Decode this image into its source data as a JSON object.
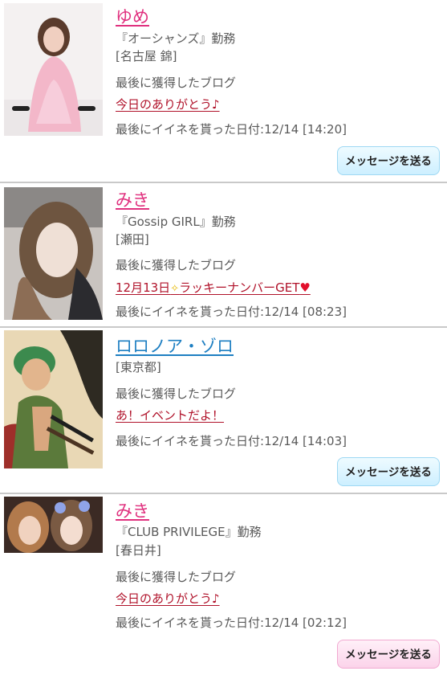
{
  "labels": {
    "last_blog": "最後に獲得したブログ",
    "last_like_prefix": "最後にイイネを貰った日付:",
    "message_button": "メッセージを送る"
  },
  "cards": [
    {
      "name": "ゆめ",
      "name_color": "#e0307e",
      "shop": "『オーシャンズ』勤務",
      "area": "[名古屋 錦]",
      "blog_title": "今日のありがとう♪",
      "like_date": "12/14 [14:20]"
    },
    {
      "name": "みき",
      "name_color": "#e0307e",
      "shop": "『Gossip GIRL』勤務",
      "area": "[瀬田]",
      "blog_title_a": "12月13日",
      "blog_title_b": "ラッキーナンバーGET",
      "like_date": "12/14 [08:23]"
    },
    {
      "name": "ロロノア・ゾロ",
      "name_color": "#1e7fc2",
      "area": "[東京都]",
      "blog_title": "あ！イベントだよ！",
      "like_date": "12/14 [14:03]"
    },
    {
      "name": "みき",
      "name_color": "#e0307e",
      "shop": "『CLUB PRIVILEGE』勤務",
      "area": "[春日井]",
      "blog_title": "今日のありがとう♪",
      "like_date": "12/14 [02:12]"
    }
  ],
  "icons": {
    "sparkle": "sparkle-icon",
    "heart": "heart-icon"
  },
  "colors": {
    "name_pink": "#e0307e",
    "name_blue": "#1e7fc2",
    "blog_link": "#b0122a",
    "button_blue_border": "#9ed8f3",
    "button_pink_border": "#f1a9d1"
  }
}
